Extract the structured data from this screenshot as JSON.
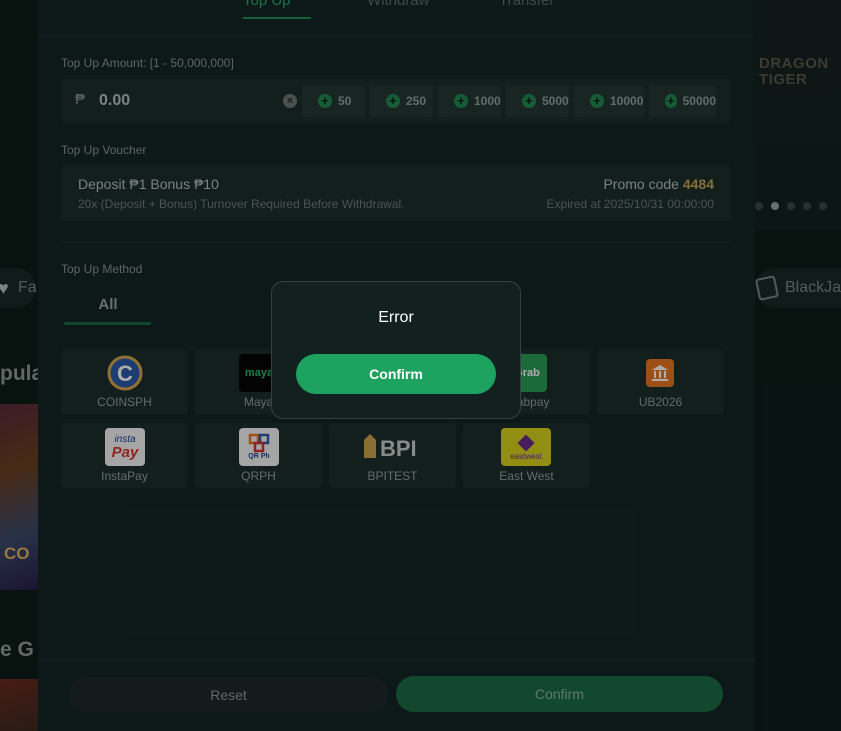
{
  "tabs": [
    {
      "label": "Top Up"
    },
    {
      "label": "Withdraw"
    },
    {
      "label": "Transfer"
    }
  ],
  "amount": {
    "label": "Top Up Amount: [1 - 50,000,000]",
    "currency_symbol": "₱",
    "placeholder": "0.00",
    "quick_amounts": [
      "50",
      "250",
      "1000",
      "5000",
      "10000",
      "50000"
    ]
  },
  "voucher": {
    "label": "Top Up Voucher",
    "title": "Deposit ₱1 Bonus ₱10",
    "subtitle": "20x (Deposit + Bonus) Turnover Required Before Withdrawal.",
    "promo_prefix": "Promo code",
    "promo_code": "4484",
    "expiry": "Expired at 2025/10/31 00:00:00"
  },
  "method": {
    "label": "Top Up Method",
    "tab_all": "All",
    "items": [
      {
        "name": "COINSPH",
        "logo": "C"
      },
      {
        "name": "Maya",
        "logo": "maya"
      },
      {
        "name": "Grabpay",
        "logo": "Grab"
      },
      {
        "name": "UB2026",
        "logo": "bank"
      },
      {
        "name": "InstaPay",
        "logo": "insta Pay"
      },
      {
        "name": "QRPH",
        "logo": "QR Ph"
      },
      {
        "name": "BPITEST",
        "logo": "BPI"
      },
      {
        "name": "East West",
        "logo": "eastwest"
      }
    ]
  },
  "footer": {
    "reset_label": "Reset",
    "confirm_label": "Confirm"
  },
  "dialog": {
    "title": "Error",
    "confirm_label": "Confirm"
  },
  "background": {
    "left_chip": "Fa",
    "popular_heading": "pula",
    "left_thumb_text": "CO",
    "game_heading": "e G",
    "right_chip": "BlackJa",
    "right_banner": "DRAGON TIGER"
  },
  "colors": {
    "accent": "#1ea25f",
    "promo": "#c2a452",
    "panel": "#142624"
  }
}
